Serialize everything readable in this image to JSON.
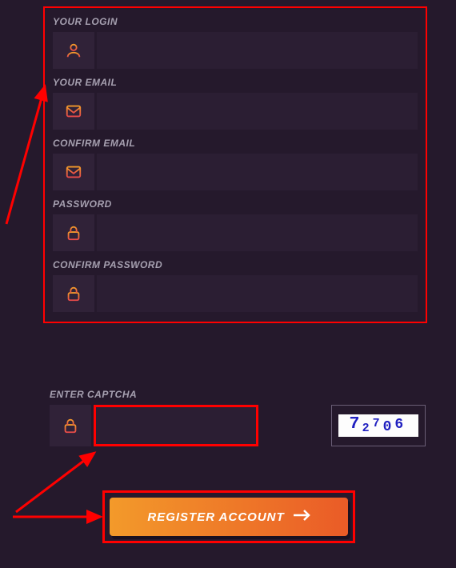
{
  "fields": {
    "login": {
      "label": "YOUR LOGIN"
    },
    "email": {
      "label": "YOUR EMAIL"
    },
    "confirm_email": {
      "label": "CONFIRM EMAIL"
    },
    "password": {
      "label": "PASSWORD"
    },
    "confirm_password": {
      "label": "CONFIRM PASSWORD"
    }
  },
  "captcha": {
    "label": "ENTER CAPTCHA",
    "code": "72706"
  },
  "button": {
    "label": "REGISTER ACCOUNT"
  }
}
